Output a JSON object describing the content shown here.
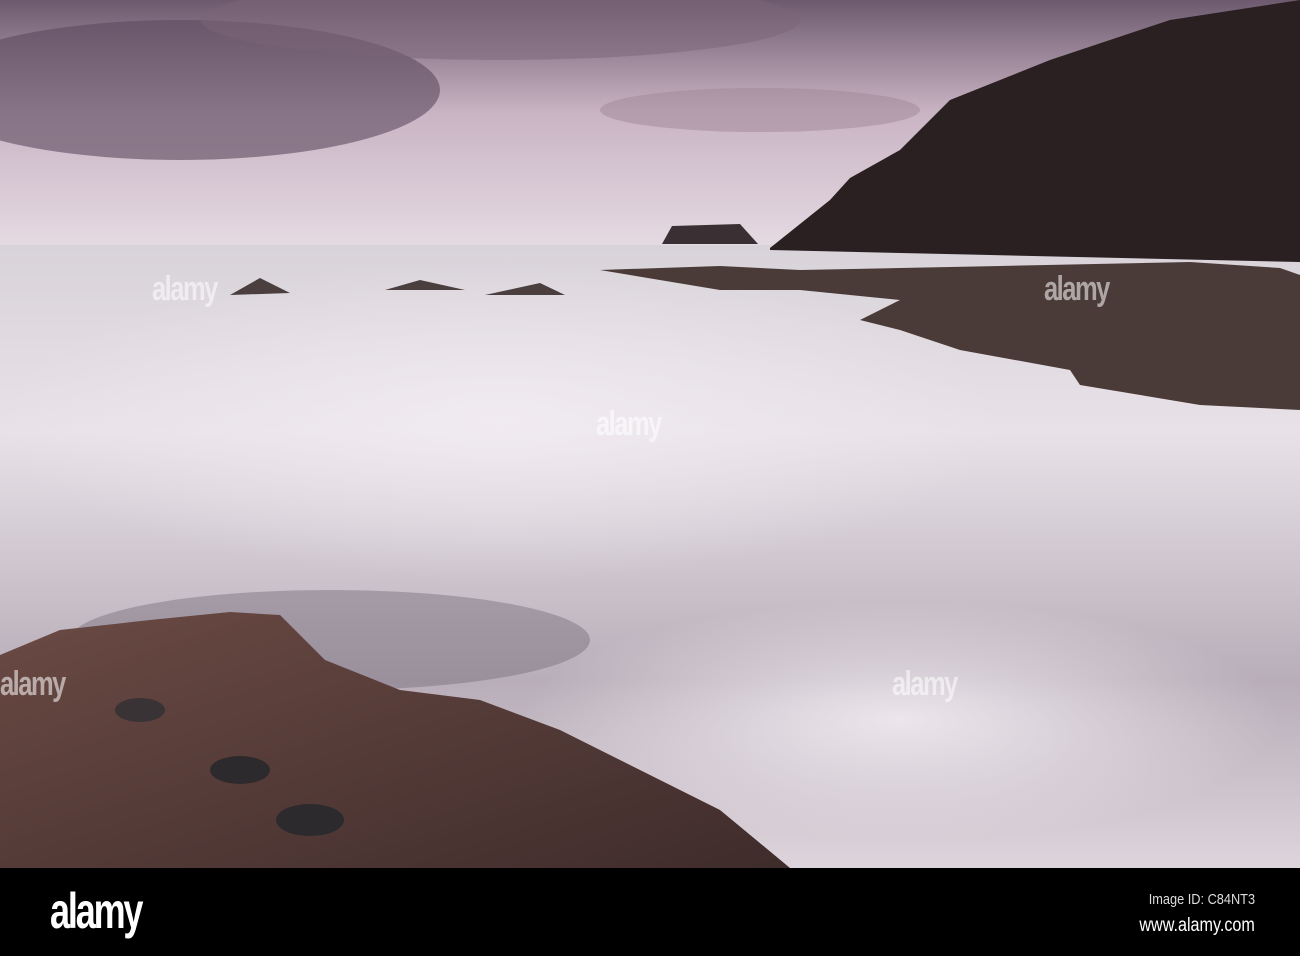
{
  "watermark": "alamy",
  "footer": {
    "logo": "alamy",
    "image_id": "Image ID: C84NT3",
    "url": "www.alamy.com"
  }
}
